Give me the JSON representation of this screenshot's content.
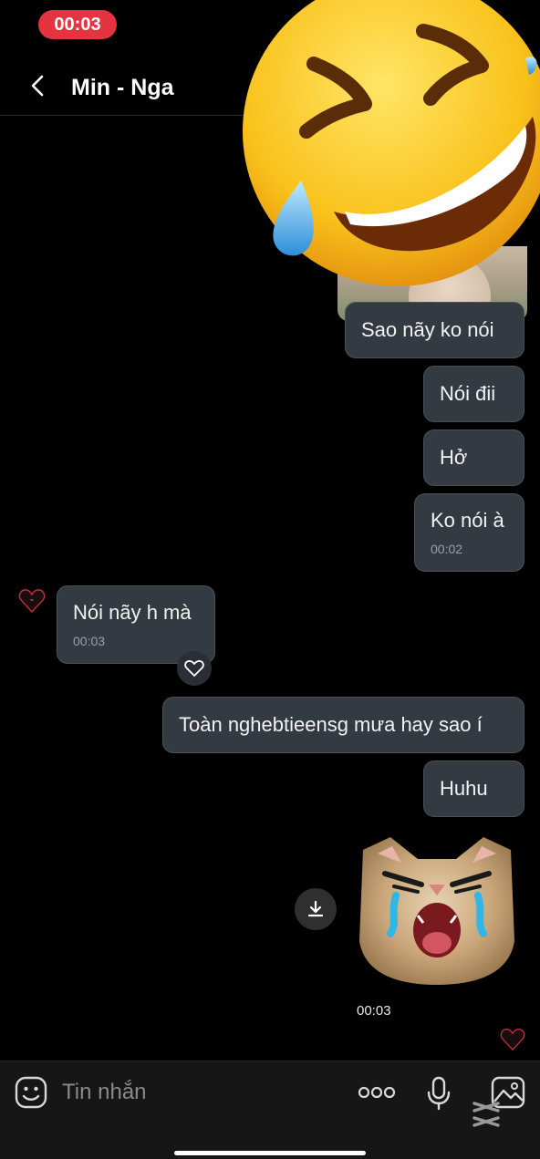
{
  "status": {
    "call_timer": "00:03"
  },
  "header": {
    "title": "Min - Nga"
  },
  "messages": [
    {
      "id": "m1",
      "side": "right",
      "text": "Sao nãy ko nói",
      "time": ""
    },
    {
      "id": "m2",
      "side": "right",
      "text": "Nói đii",
      "time": ""
    },
    {
      "id": "m3",
      "side": "right",
      "text": "Hở",
      "time": ""
    },
    {
      "id": "m4",
      "side": "right",
      "text": "Ko nói à",
      "time": "00:02"
    },
    {
      "id": "m5",
      "side": "left",
      "text": "Nói nãy h mà",
      "time": "00:03"
    },
    {
      "id": "m6",
      "side": "right",
      "text": "Toàn nghebtieensg mưa hay sao í",
      "time": ""
    },
    {
      "id": "m7",
      "side": "right",
      "text": "Huhu",
      "time": ""
    },
    {
      "id": "m8",
      "side": "right",
      "type": "sticker",
      "sticker": "crying-cat",
      "time": "00:03"
    }
  ],
  "input": {
    "placeholder": "Tin nhắn"
  },
  "icons": {
    "back": "chevron-left-icon",
    "like": "heart-icon",
    "download": "download-icon",
    "emoji": "emoji-icon",
    "more": "more-icon",
    "mic": "microphone-icon",
    "gallery": "image-icon",
    "overlay": "rolling-on-floor-laughing-emoji"
  },
  "colors": {
    "background": "#000000",
    "bubble": "#343a42",
    "status_pill": "#e5333f"
  }
}
